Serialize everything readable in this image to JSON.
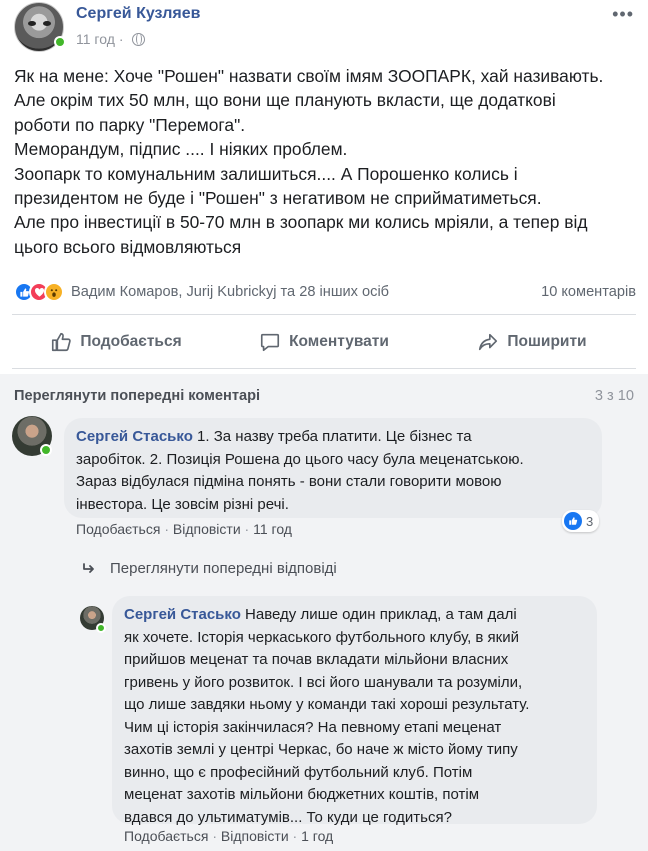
{
  "post": {
    "author": "Сергей Кузляев",
    "time": "11 год",
    "dot": "·",
    "more_glyph": "•••",
    "text_lines": [
      "Як на мене: Хоче \"Рошен\" назвати своїм імям ЗООПАРК, хай називають.",
      "Але окрім тих 50 млн, що вони ще планують вкласти, ще додаткові",
      "роботи по парку \"Перемога\".",
      "Меморандум, підпис .... І ніяких проблем.",
      "Зоопарк то комунальним залишиться.... А Порошенко колись і",
      "президентом не буде і \"Рошен\" з негативом не сприйматиметься.",
      "Але про інвестиції в 50-70 млн в зоопарк ми колись мріяли, а тепер від",
      "цього всього відмовляються"
    ],
    "reactors": "Вадим Комаров, Jurij Kubrickyj та 28 інших осіб",
    "comments_count": "10 коментарів"
  },
  "actions": {
    "like": "Подобається",
    "comment": "Коментувати",
    "share": "Поширити"
  },
  "comments": {
    "prev_label": "Переглянути попередні коментарі",
    "counter": "3 з 10",
    "first": {
      "author": "Сергей Стасько",
      "lines": [
        " 1. За назву треба платити. Це бізнес та",
        "заробіток. 2. Позиція Рошена до цього часу була меценатською.",
        "Зараз відбулася підміна понять - вони стали говорити мовою",
        "інвестора. Це зовсім різні речі."
      ],
      "like": "Подобається",
      "reply": "Відповісти",
      "time": "11 год",
      "sep": "·",
      "reactions": "3"
    },
    "prev_replies_label": "Переглянути попередні відповіді",
    "reply": {
      "author": "Сергей Стасько",
      "lines": [
        " Наведу лише один приклад, а там далі",
        "як хочете. Історія черкаського футбольного клубу, в який",
        "прийшов меценат та почав вкладати мільйони власних",
        "гривень у його розвиток. І всі його шанували та розуміли,",
        "що лише завдяки ньому у команди такі хороші результату.",
        "Чим ці історія закінчилася? На певному етапі меценат",
        "захотів землі у центрі Черкас, бо наче ж місто йому типу",
        "винно, що є професійний футбольний клуб. Потім",
        "меценат захотів мільйони бюджетних коштів, потім",
        "вдався до ультиматумів... То куди це годиться?"
      ],
      "like": "Подобається",
      "reply": "Відповісти",
      "time": "1 год",
      "sep": "·"
    }
  },
  "colors": {
    "link_blue": "#385898",
    "like_blue": "#1877f2",
    "love_red": "#f33e58",
    "wow_yellow": "#f7b125",
    "online_green": "#42b72a"
  },
  "icons": [
    "globe-icon",
    "like-reaction-icon",
    "love-reaction-icon",
    "wow-reaction-icon",
    "thumbs-up-icon",
    "comment-icon",
    "share-icon",
    "reply-arrow-icon"
  ]
}
